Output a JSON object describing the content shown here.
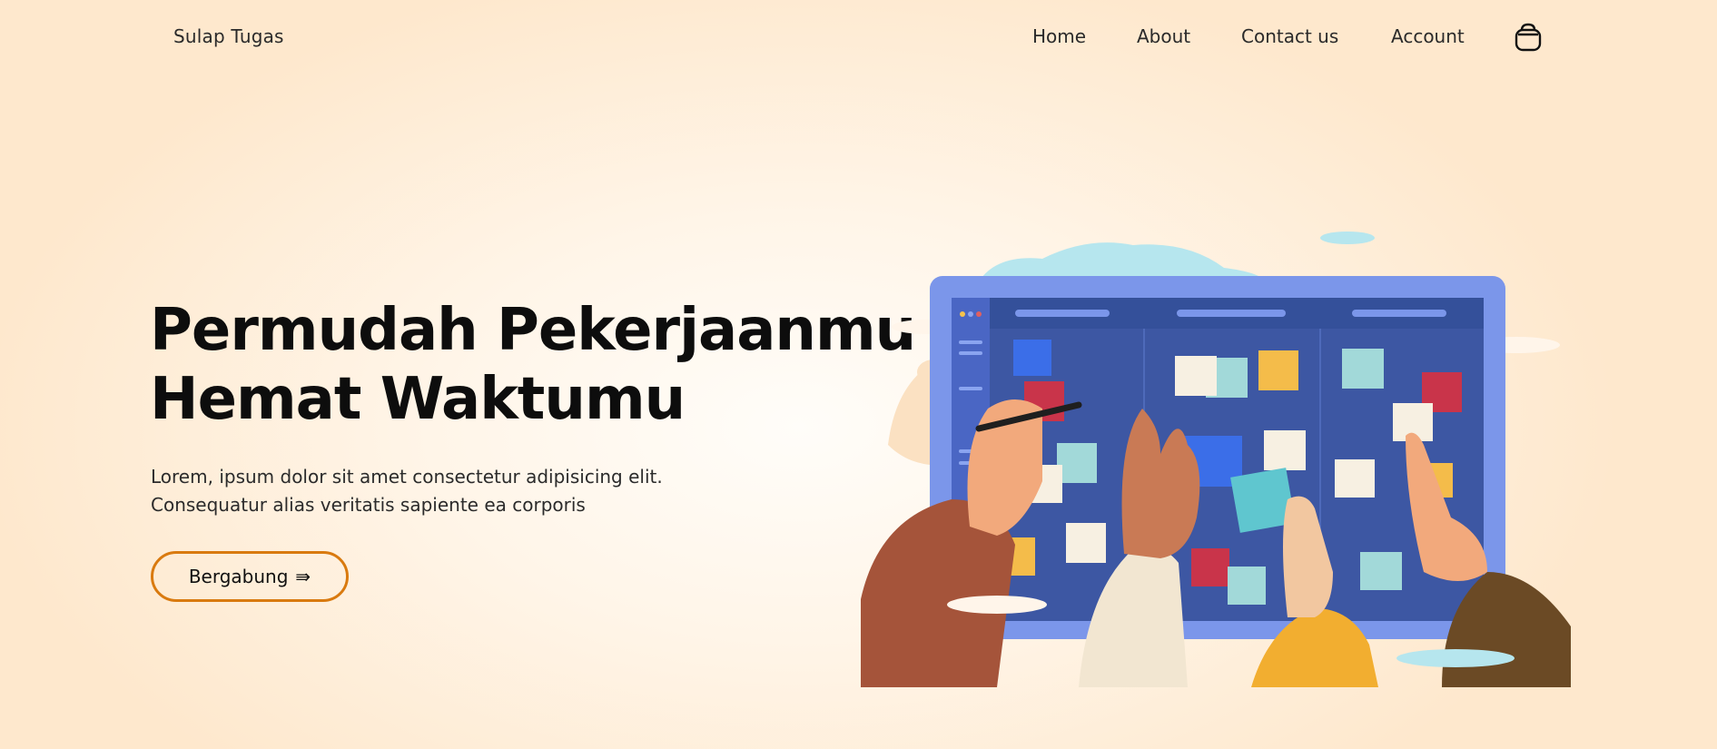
{
  "brand": {
    "name": "Sulap Tugas"
  },
  "nav": {
    "items": [
      {
        "label": "Home"
      },
      {
        "label": "About"
      },
      {
        "label": "Contact us"
      },
      {
        "label": "Account"
      }
    ],
    "cart_icon": "shopping-bag-icon"
  },
  "hero": {
    "title_line1": "Permudah Pekerjaanmu",
    "title_line2": "Hemat Waktumu",
    "desc_line1": "Lorem, ipsum dolor sit amet consectetur adipisicing elit.",
    "desc_line2": "Consequatur alias veritatis sapiente ea corporis",
    "cta_label": "Bergabung",
    "cta_icon": "⇛"
  },
  "colors": {
    "accent": "#d97a0f",
    "board": "#3d57a3",
    "board_frame": "#7b96ea"
  }
}
